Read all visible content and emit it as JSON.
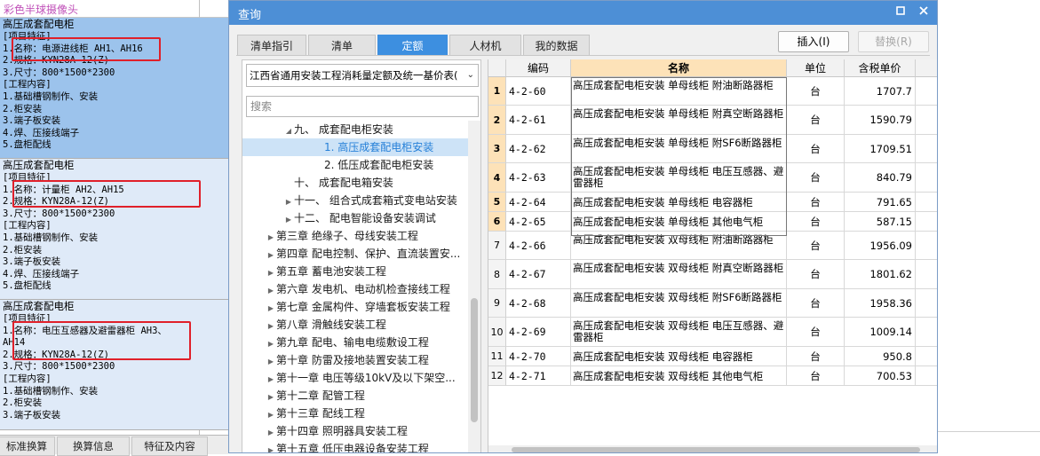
{
  "left_panel": {
    "top_item": "彩色半球摄像头",
    "blocks": [
      {
        "lines": [
          "高压成套配电柜",
          "[项目特征]",
          "1.名称：电源进线柜 AH1、AH16",
          "2.规格：KYN28A-12(Z)",
          "3.尺寸：800*1500*2300",
          "[工程内容]",
          "1.基础槽钢制作、安装",
          "2.柜安装",
          "3.端子板安装",
          "4.焊、压接线端子",
          "5.盘柜配线"
        ]
      },
      {
        "lines": [
          "高压成套配电柜",
          "[项目特征]",
          "1.名称：计量柜 AH2、AH15",
          "2.规格：KYN28A-12(Z)",
          "3.尺寸：800*1500*2300",
          "[工程内容]",
          "1.基础槽钢制作、安装",
          "2.柜安装",
          "3.端子板安装",
          "4.焊、压接线端子",
          "5.盘柜配线"
        ]
      },
      {
        "lines": [
          "高压成套配电柜",
          "[项目特征]",
          "1.名称：电压互感器及避雷器柜 AH3、",
          "AH14",
          "2.规格：KYN28A-12(Z)",
          "3.尺寸：800*1500*2300",
          "[工程内容]",
          "1.基础槽钢制作、安装",
          "2.柜安装",
          "3.端子板安装"
        ]
      }
    ],
    "bottom_tabs": [
      "标准换算",
      "换算信息",
      "特征及内容"
    ]
  },
  "dialog": {
    "title": "查询",
    "tabs": [
      "清单指引",
      "清单",
      "定额",
      "人材机",
      "我的数据"
    ],
    "active_tab": "定额",
    "insert_button": "插入(I)",
    "replace_button": "替换(R)",
    "library_select": "江西省通用安装工程消耗量定额及统一基价表(",
    "search_placeholder": "搜索",
    "tree": [
      {
        "label": "九、 成套配电柜安装",
        "level": 2,
        "expanded": true
      },
      {
        "label": "1. 高压成套配电柜安装",
        "level": 3,
        "selected": true
      },
      {
        "label": "2. 低压成套配电柜安装",
        "level": 3
      },
      {
        "label": "十、 成套配电箱安装",
        "level": 2
      },
      {
        "label": "十一、 组合式成套箱式变电站安装",
        "level": 2,
        "collapsed": true
      },
      {
        "label": "十二、 配电智能设备安装调试",
        "level": 2,
        "collapsed": true
      },
      {
        "label": "第三章 绝缘子、母线安装工程",
        "level": 1,
        "collapsed": true
      },
      {
        "label": "第四章 配电控制、保护、直流装置安...",
        "level": 1,
        "collapsed": true
      },
      {
        "label": "第五章 蓄电池安装工程",
        "level": 1,
        "collapsed": true
      },
      {
        "label": "第六章 发电机、电动机检查接线工程",
        "level": 1,
        "collapsed": true
      },
      {
        "label": "第七章 金属构件、穿墙套板安装工程",
        "level": 1,
        "collapsed": true
      },
      {
        "label": "第八章 滑触线安装工程",
        "level": 1,
        "collapsed": true
      },
      {
        "label": "第九章 配电、输电电缆敷设工程",
        "level": 1,
        "collapsed": true
      },
      {
        "label": "第十章 防雷及接地装置安装工程",
        "level": 1,
        "collapsed": true
      },
      {
        "label": "第十一章 电压等级10kV及以下架空...",
        "level": 1,
        "collapsed": true
      },
      {
        "label": "第十二章 配管工程",
        "level": 1,
        "collapsed": true
      },
      {
        "label": "第十三章 配线工程",
        "level": 1,
        "collapsed": true
      },
      {
        "label": "第十四章 照明器具安装工程",
        "level": 1,
        "collapsed": true
      },
      {
        "label": "第十五章 低压电器设备安装工程",
        "level": 1,
        "collapsed": true
      }
    ],
    "grid": {
      "columns": [
        "编码",
        "名称",
        "单位",
        "含税单价"
      ],
      "rows": [
        {
          "no": "1",
          "code": "4-2-60",
          "name": "高压成套配电柜安装 单母线柜 附油断路器柜",
          "unit": "台",
          "price": "1707.7"
        },
        {
          "no": "2",
          "code": "4-2-61",
          "name": "高压成套配电柜安装 单母线柜 附真空断路器柜",
          "unit": "台",
          "price": "1590.79"
        },
        {
          "no": "3",
          "code": "4-2-62",
          "name": "高压成套配电柜安装 单母线柜 附SF6断路器柜",
          "unit": "台",
          "price": "1709.51"
        },
        {
          "no": "4",
          "code": "4-2-63",
          "name": "高压成套配电柜安装 单母线柜 电压互感器、避雷器柜",
          "unit": "台",
          "price": "840.79"
        },
        {
          "no": "5",
          "code": "4-2-64",
          "name": "高压成套配电柜安装 单母线柜 电容器柜",
          "unit": "台",
          "price": "791.65"
        },
        {
          "no": "6",
          "code": "4-2-65",
          "name": "高压成套配电柜安装 单母线柜 其他电气柜",
          "unit": "台",
          "price": "587.15"
        },
        {
          "no": "7",
          "code": "4-2-66",
          "name": "高压成套配电柜安装 双母线柜 附油断路器柜",
          "unit": "台",
          "price": "1956.09"
        },
        {
          "no": "8",
          "code": "4-2-67",
          "name": "高压成套配电柜安装 双母线柜 附真空断路器柜",
          "unit": "台",
          "price": "1801.62"
        },
        {
          "no": "9",
          "code": "4-2-68",
          "name": "高压成套配电柜安装 双母线柜 附SF6断路器柜",
          "unit": "台",
          "price": "1958.36"
        },
        {
          "no": "10",
          "code": "4-2-69",
          "name": "高压成套配电柜安装 双母线柜 电压互感器、避雷器柜",
          "unit": "台",
          "price": "1009.14"
        },
        {
          "no": "11",
          "code": "4-2-70",
          "name": "高压成套配电柜安装 双母线柜 电容器柜",
          "unit": "台",
          "price": "950.8"
        },
        {
          "no": "12",
          "code": "4-2-71",
          "name": "高压成套配电柜安装 双母线柜 其他电气柜",
          "unit": "台",
          "price": "700.53"
        }
      ]
    }
  },
  "colors": {
    "titlebar": "#4d8fd6",
    "active_tab": "#3d8fe0",
    "selected_block": "#9cc3ec",
    "highlight": "#e0202a"
  }
}
